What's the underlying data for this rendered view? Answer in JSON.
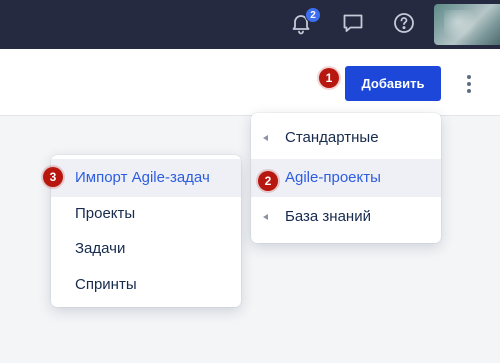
{
  "topbar": {
    "notifications_count": "2",
    "icons": [
      "bell-icon",
      "chat-icon",
      "help-icon"
    ]
  },
  "header": {
    "add_button_label": "Добавить",
    "step_1": "1"
  },
  "submenu_main": {
    "items": [
      {
        "label": "Стандартные",
        "has_submenu": true
      },
      {
        "label": "Agile-проекты",
        "has_submenu": true,
        "step": "2",
        "active": true
      },
      {
        "label": "База знаний",
        "has_submenu": true
      }
    ]
  },
  "submenu_agile": {
    "items": [
      {
        "label": "Импорт Agile-задач",
        "step": "3",
        "active": true
      },
      {
        "label": "Проекты"
      },
      {
        "label": "Задачи"
      },
      {
        "label": "Спринты"
      }
    ]
  },
  "colors": {
    "topbar": "#252a40",
    "primary": "#1c47d9",
    "step_badge": "#b8170f",
    "link": "#2d5de0"
  }
}
